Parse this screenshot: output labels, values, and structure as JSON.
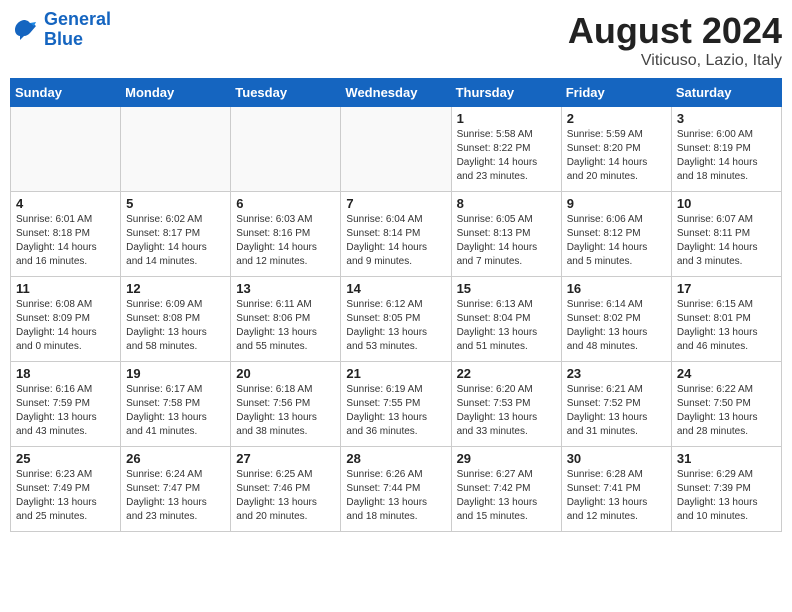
{
  "header": {
    "logo_line1": "General",
    "logo_line2": "Blue",
    "title": "August 2024",
    "subtitle": "Viticuso, Lazio, Italy"
  },
  "weekdays": [
    "Sunday",
    "Monday",
    "Tuesday",
    "Wednesday",
    "Thursday",
    "Friday",
    "Saturday"
  ],
  "weeks": [
    [
      {
        "day": "",
        "info": ""
      },
      {
        "day": "",
        "info": ""
      },
      {
        "day": "",
        "info": ""
      },
      {
        "day": "",
        "info": ""
      },
      {
        "day": "1",
        "info": "Sunrise: 5:58 AM\nSunset: 8:22 PM\nDaylight: 14 hours\nand 23 minutes."
      },
      {
        "day": "2",
        "info": "Sunrise: 5:59 AM\nSunset: 8:20 PM\nDaylight: 14 hours\nand 20 minutes."
      },
      {
        "day": "3",
        "info": "Sunrise: 6:00 AM\nSunset: 8:19 PM\nDaylight: 14 hours\nand 18 minutes."
      }
    ],
    [
      {
        "day": "4",
        "info": "Sunrise: 6:01 AM\nSunset: 8:18 PM\nDaylight: 14 hours\nand 16 minutes."
      },
      {
        "day": "5",
        "info": "Sunrise: 6:02 AM\nSunset: 8:17 PM\nDaylight: 14 hours\nand 14 minutes."
      },
      {
        "day": "6",
        "info": "Sunrise: 6:03 AM\nSunset: 8:16 PM\nDaylight: 14 hours\nand 12 minutes."
      },
      {
        "day": "7",
        "info": "Sunrise: 6:04 AM\nSunset: 8:14 PM\nDaylight: 14 hours\nand 9 minutes."
      },
      {
        "day": "8",
        "info": "Sunrise: 6:05 AM\nSunset: 8:13 PM\nDaylight: 14 hours\nand 7 minutes."
      },
      {
        "day": "9",
        "info": "Sunrise: 6:06 AM\nSunset: 8:12 PM\nDaylight: 14 hours\nand 5 minutes."
      },
      {
        "day": "10",
        "info": "Sunrise: 6:07 AM\nSunset: 8:11 PM\nDaylight: 14 hours\nand 3 minutes."
      }
    ],
    [
      {
        "day": "11",
        "info": "Sunrise: 6:08 AM\nSunset: 8:09 PM\nDaylight: 14 hours\nand 0 minutes."
      },
      {
        "day": "12",
        "info": "Sunrise: 6:09 AM\nSunset: 8:08 PM\nDaylight: 13 hours\nand 58 minutes."
      },
      {
        "day": "13",
        "info": "Sunrise: 6:11 AM\nSunset: 8:06 PM\nDaylight: 13 hours\nand 55 minutes."
      },
      {
        "day": "14",
        "info": "Sunrise: 6:12 AM\nSunset: 8:05 PM\nDaylight: 13 hours\nand 53 minutes."
      },
      {
        "day": "15",
        "info": "Sunrise: 6:13 AM\nSunset: 8:04 PM\nDaylight: 13 hours\nand 51 minutes."
      },
      {
        "day": "16",
        "info": "Sunrise: 6:14 AM\nSunset: 8:02 PM\nDaylight: 13 hours\nand 48 minutes."
      },
      {
        "day": "17",
        "info": "Sunrise: 6:15 AM\nSunset: 8:01 PM\nDaylight: 13 hours\nand 46 minutes."
      }
    ],
    [
      {
        "day": "18",
        "info": "Sunrise: 6:16 AM\nSunset: 7:59 PM\nDaylight: 13 hours\nand 43 minutes."
      },
      {
        "day": "19",
        "info": "Sunrise: 6:17 AM\nSunset: 7:58 PM\nDaylight: 13 hours\nand 41 minutes."
      },
      {
        "day": "20",
        "info": "Sunrise: 6:18 AM\nSunset: 7:56 PM\nDaylight: 13 hours\nand 38 minutes."
      },
      {
        "day": "21",
        "info": "Sunrise: 6:19 AM\nSunset: 7:55 PM\nDaylight: 13 hours\nand 36 minutes."
      },
      {
        "day": "22",
        "info": "Sunrise: 6:20 AM\nSunset: 7:53 PM\nDaylight: 13 hours\nand 33 minutes."
      },
      {
        "day": "23",
        "info": "Sunrise: 6:21 AM\nSunset: 7:52 PM\nDaylight: 13 hours\nand 31 minutes."
      },
      {
        "day": "24",
        "info": "Sunrise: 6:22 AM\nSunset: 7:50 PM\nDaylight: 13 hours\nand 28 minutes."
      }
    ],
    [
      {
        "day": "25",
        "info": "Sunrise: 6:23 AM\nSunset: 7:49 PM\nDaylight: 13 hours\nand 25 minutes."
      },
      {
        "day": "26",
        "info": "Sunrise: 6:24 AM\nSunset: 7:47 PM\nDaylight: 13 hours\nand 23 minutes."
      },
      {
        "day": "27",
        "info": "Sunrise: 6:25 AM\nSunset: 7:46 PM\nDaylight: 13 hours\nand 20 minutes."
      },
      {
        "day": "28",
        "info": "Sunrise: 6:26 AM\nSunset: 7:44 PM\nDaylight: 13 hours\nand 18 minutes."
      },
      {
        "day": "29",
        "info": "Sunrise: 6:27 AM\nSunset: 7:42 PM\nDaylight: 13 hours\nand 15 minutes."
      },
      {
        "day": "30",
        "info": "Sunrise: 6:28 AM\nSunset: 7:41 PM\nDaylight: 13 hours\nand 12 minutes."
      },
      {
        "day": "31",
        "info": "Sunrise: 6:29 AM\nSunset: 7:39 PM\nDaylight: 13 hours\nand 10 minutes."
      }
    ]
  ]
}
